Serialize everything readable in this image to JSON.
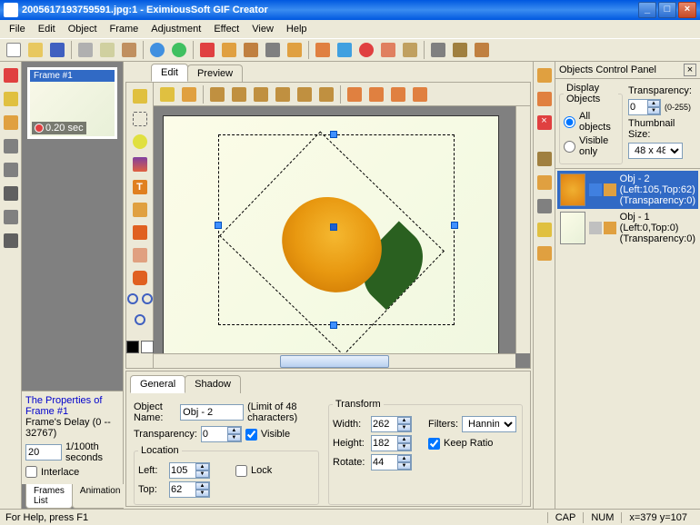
{
  "titlebar": {
    "text": "2005617193759591.jpg:1 - EximiousSoft GIF Creator"
  },
  "winbtns": {
    "min": "_",
    "max": "□",
    "close": "×"
  },
  "menu": [
    "File",
    "Edit",
    "Object",
    "Frame",
    "Adjustment",
    "Effect",
    "View",
    "Help"
  ],
  "frames": {
    "frame1": {
      "title": "Frame #1",
      "delay": "0.20 sec"
    },
    "props_title": "The Properties of Frame #1",
    "delay_label": "Frame's Delay (0 -- 32767)",
    "delay_value": "20",
    "delay_unit": "1/100th seconds",
    "interlace": "Interlace"
  },
  "bottom_tabs": {
    "frames": "Frames List",
    "anim": "Animation"
  },
  "edit_tabs": {
    "edit": "Edit",
    "preview": "Preview"
  },
  "general": {
    "tab_general": "General",
    "tab_shadow": "Shadow",
    "obj_name_label": "Object Name:",
    "obj_name": "Obj - 2",
    "obj_name_hint": "(Limit of 48 characters)",
    "transparency_label": "Transparency:",
    "transparency": "0",
    "visible": "Visible",
    "location": "Location",
    "left_label": "Left:",
    "left": "105",
    "top_label": "Top:",
    "top": "62",
    "lock": "Lock",
    "transform": "Transform",
    "width_label": "Width:",
    "width": "262",
    "height_label": "Height:",
    "height": "182",
    "rotate_label": "Rotate:",
    "rotate": "44",
    "filters_label": "Filters:",
    "filter": "Hanning",
    "keep_ratio": "Keep Ratio"
  },
  "objects_panel": {
    "title": "Objects Control Panel",
    "display": "Display Objects",
    "all": "All objects",
    "visible_only": "Visible only",
    "transp_label": "Transparency:",
    "transp": "0",
    "transp_range": "(0-255)",
    "thumb_label": "Thumbnail Size:",
    "thumb_size": "48 x 48",
    "obj2": {
      "name": "Obj - 2",
      "pos": "(Left:105,Top:62)",
      "tr": "(Transparency:0)"
    },
    "obj1": {
      "name": "Obj - 1",
      "pos": "(Left:0,Top:0)",
      "tr": "(Transparency:0)"
    }
  },
  "status": {
    "help": "For Help, press F1",
    "cap": "CAP",
    "num": "NUM",
    "coord": "x=379 y=107"
  }
}
